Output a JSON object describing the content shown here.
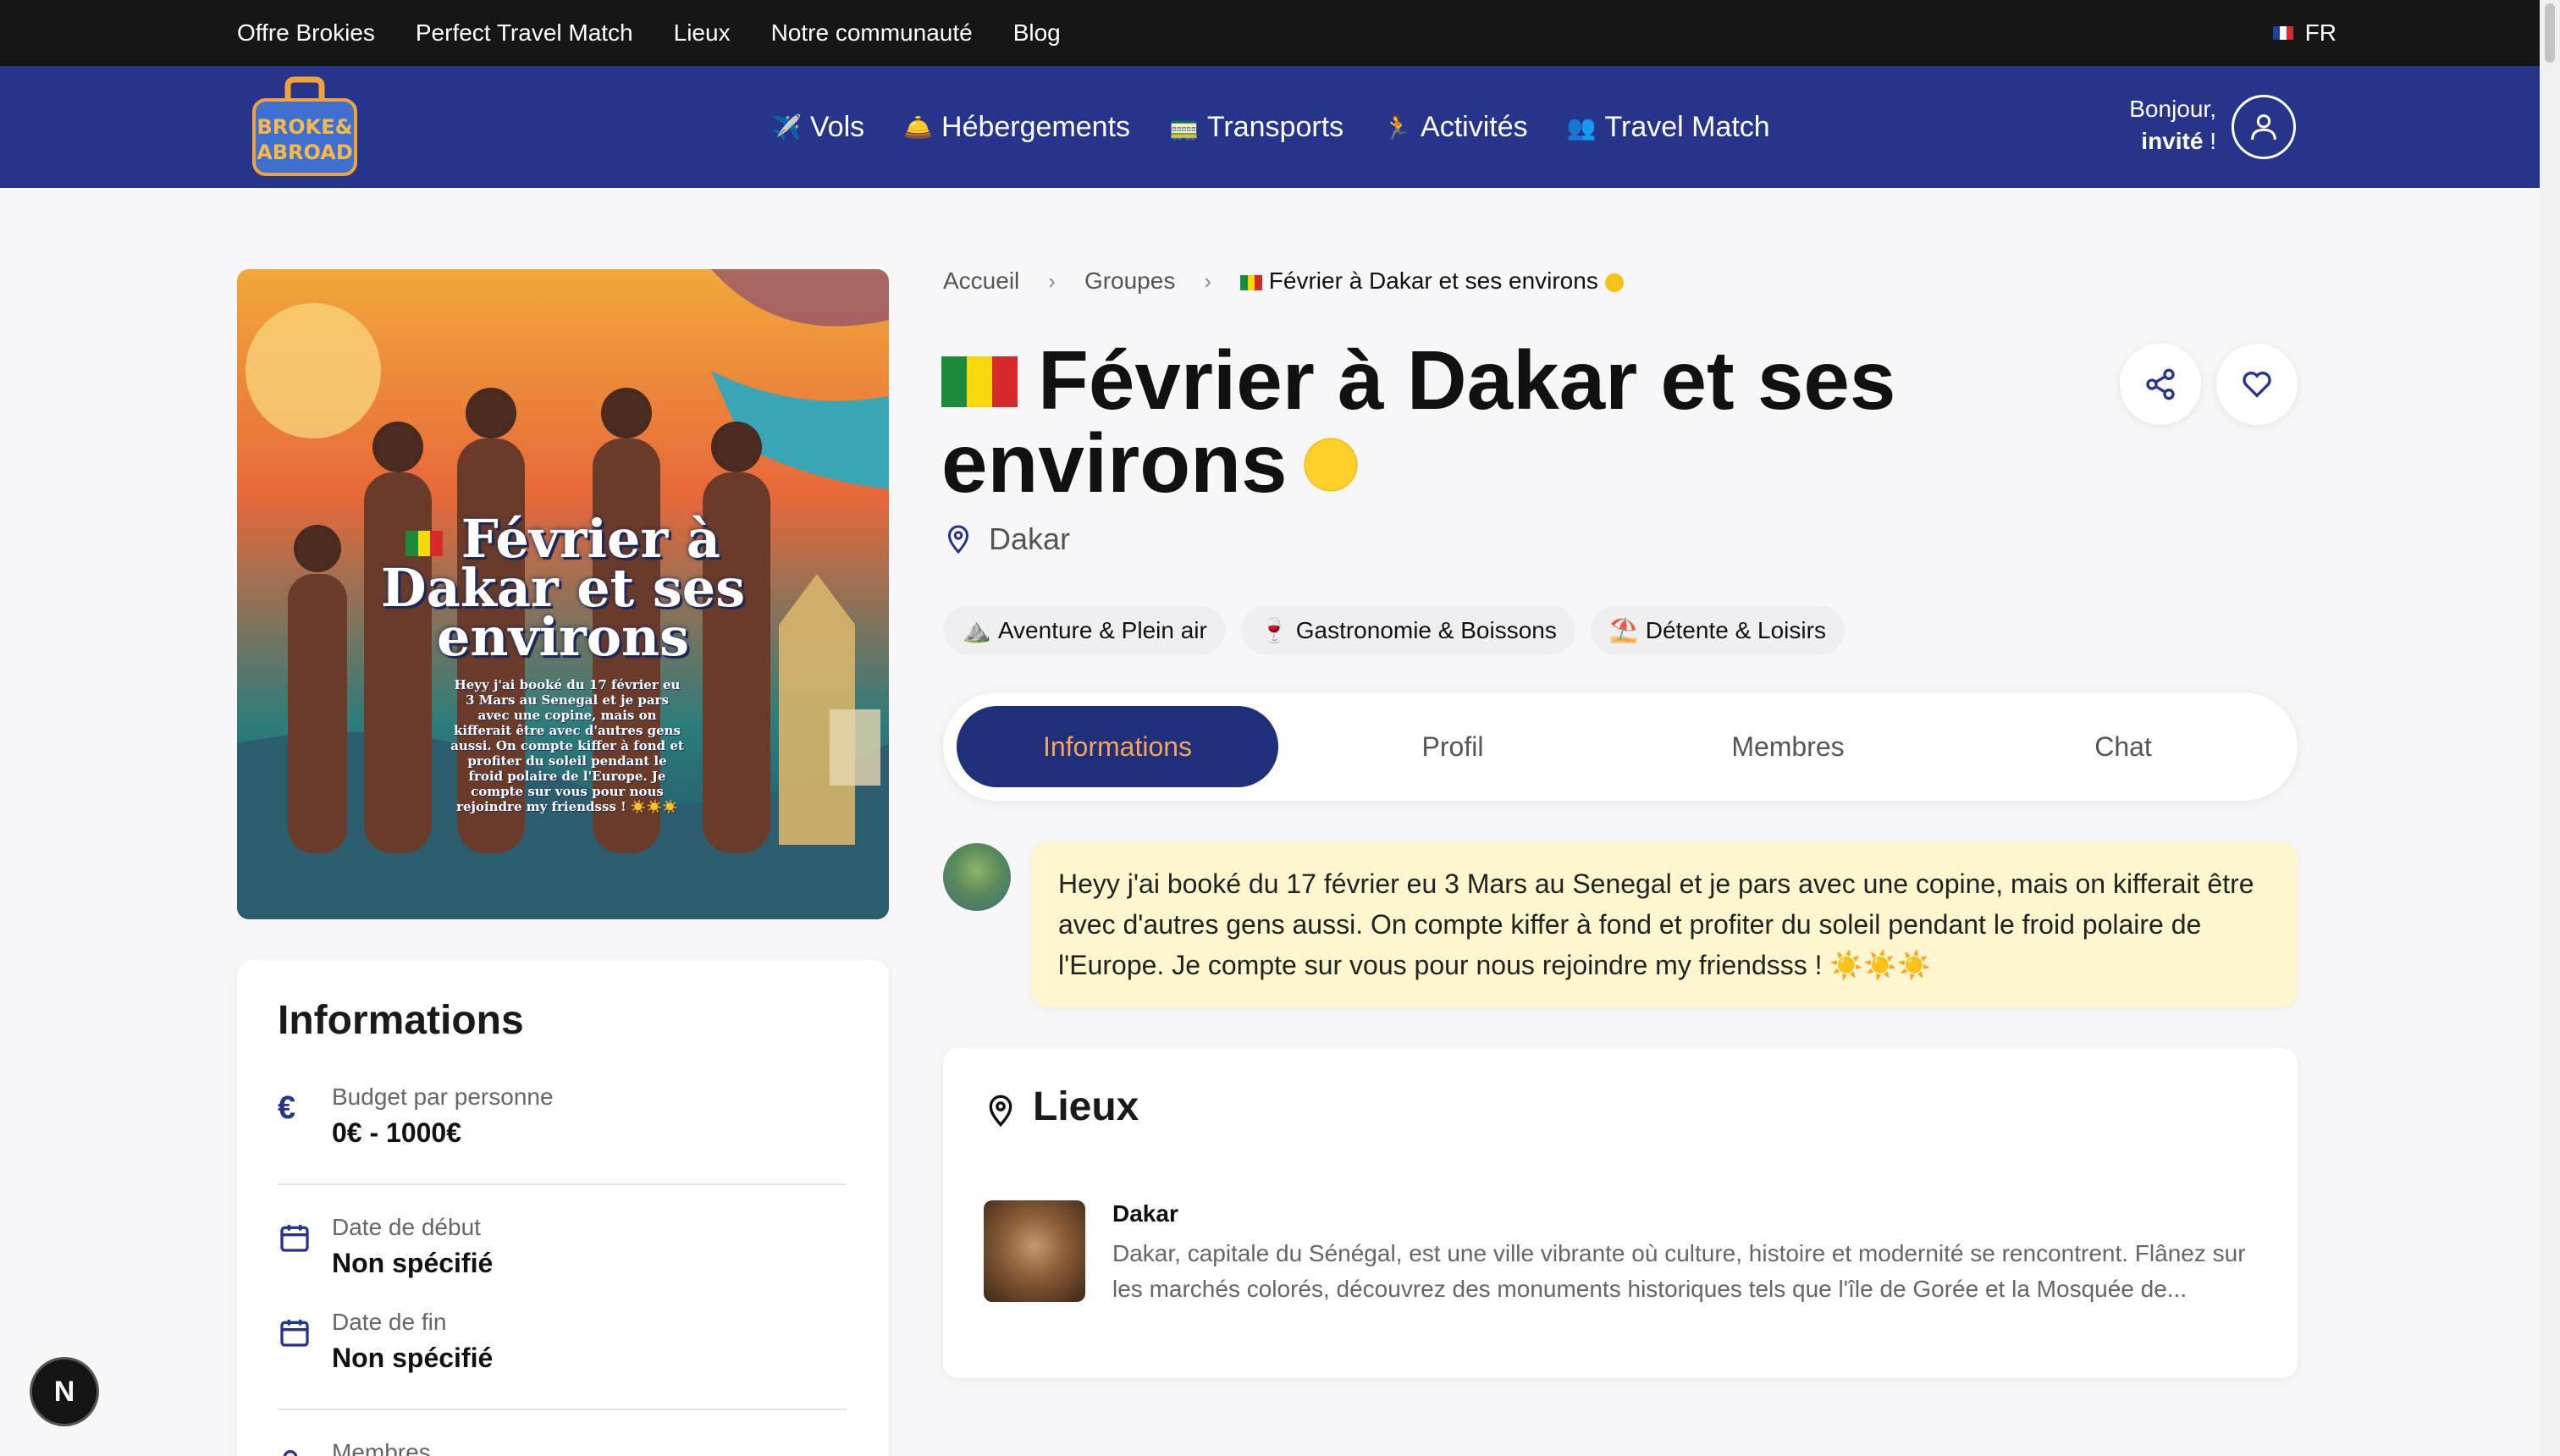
{
  "topbar": {
    "links": [
      "Offre Brokies",
      "Perfect Travel Match",
      "Lieux",
      "Notre communauté",
      "Blog"
    ],
    "language": "FR"
  },
  "nav": {
    "logo_text": "BROKE & ABROAD",
    "items": [
      {
        "icon": "✈️",
        "label": "Vols"
      },
      {
        "icon": "🛎️",
        "label": "Hébergements"
      },
      {
        "icon": "🚃",
        "label": "Transports"
      },
      {
        "icon": "🏃",
        "label": "Activités"
      },
      {
        "icon": "👥",
        "label": "Travel Match"
      }
    ],
    "greeting_line1": "Bonjour,",
    "greeting_name": "invité",
    "greeting_suffix": " !"
  },
  "breadcrumb": {
    "home": "Accueil",
    "groups": "Groupes",
    "current": "Février à Dakar et ses environs"
  },
  "group": {
    "title_line1": "Février à Dakar et ses",
    "title_line2": "environs",
    "location": "Dakar",
    "tags": [
      {
        "icon": "⛰️",
        "label": "Aventure & Plein air"
      },
      {
        "icon": "🍷",
        "label": "Gastronomie & Boissons"
      },
      {
        "icon": "⛱️",
        "label": "Détente & Loisirs"
      }
    ]
  },
  "hero": {
    "title_line1": "Février à",
    "title_line2": "Dakar et ses",
    "title_line3": "environs",
    "text": "Heyy j'ai booké du 17 février eu 3 Mars au Senegal et je pars avec une copine, mais on kifferait être avec d'autres gens aussi. On compte kiffer à fond et profiter du soleil pendant le froid polaire de l'Europe. Je compte sur vous pour nous rejoindre my friendsss ! ☀️☀️☀️"
  },
  "tabs": [
    "Informations",
    "Profil",
    "Membres",
    "Chat"
  ],
  "active_tab": "Informations",
  "message": "Heyy j'ai booké du 17 février eu 3 Mars au Senegal et je pars avec une copine, mais on kifferait être avec d'autres gens aussi. On compte kiffer à fond et profiter du soleil pendant le froid polaire de l'Europe. Je compte sur vous pour nous rejoindre my friendsss ! ☀️☀️☀️",
  "info": {
    "heading": "Informations",
    "budget_label": "Budget par personne",
    "budget_value": "0€ - 1000€",
    "start_label": "Date de début",
    "start_value": "Non spécifié",
    "end_label": "Date de fin",
    "end_value": "Non spécifié",
    "members_label": "Membres"
  },
  "places": {
    "heading": "Lieux",
    "items": [
      {
        "name": "Dakar",
        "description": "Dakar, capitale du Sénégal, est une ville vibrante où culture, histoire et modernité se rencontrent. Flânez sur les marchés colorés, découvrez des monuments historiques tels que l'île de Gorée et la Mosquée de..."
      }
    ]
  },
  "dev_badge": "N",
  "colors": {
    "topbar": "#161616",
    "navbar": "#26348b",
    "active_tab_bg": "#1f2f7a",
    "active_tab_text": "#f6a45a",
    "message_bg": "#fdf6cf"
  }
}
